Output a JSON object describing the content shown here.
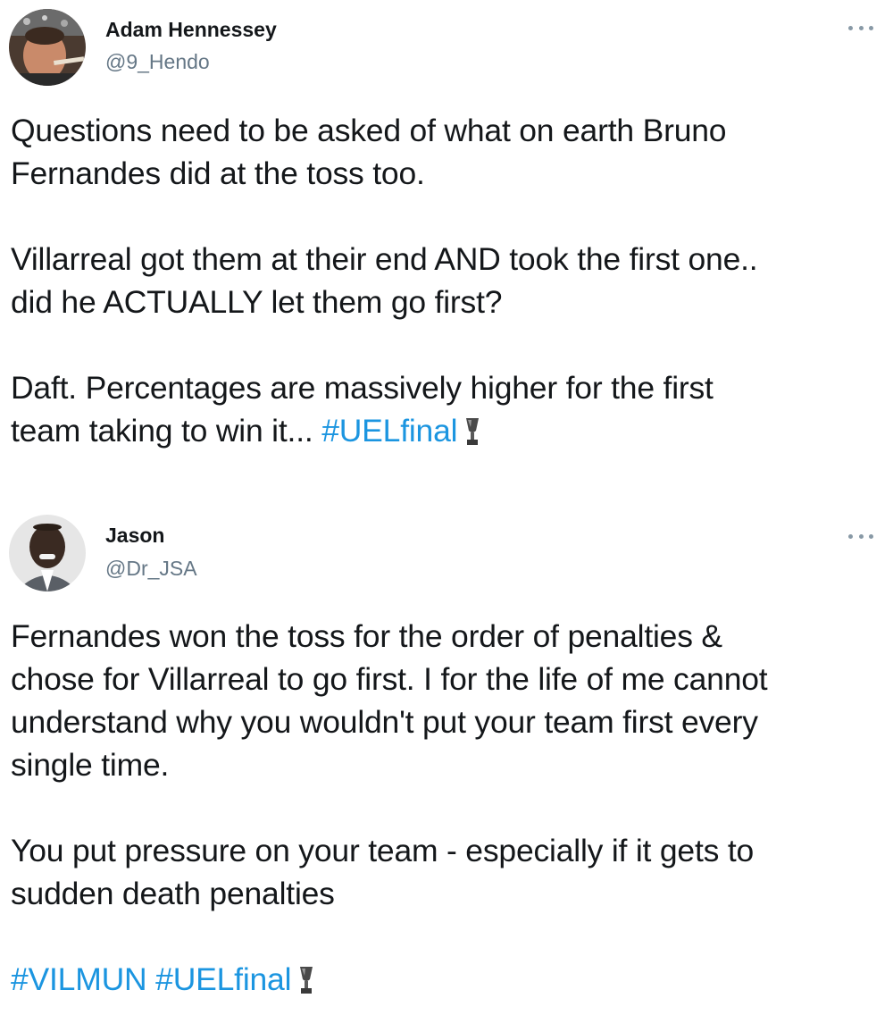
{
  "tweets": [
    {
      "author": {
        "name": "Adam Hennessey",
        "handle": "@9_Hendo",
        "avatar_icon": "profile-photo"
      },
      "more_icon": "more-options-icon",
      "paragraphs": [
        "Questions need to be asked of what on earth Bruno\nFernandes did at the toss too.",
        "Villarreal got them at their end AND took the first one..\ndid he ACTUALLY let them go first?"
      ],
      "last_paragraph": {
        "text": "Daft. Percentages are massively higher for the first\nteam taking to win it... ",
        "hashtags": [
          "#UELfinal"
        ],
        "trailing_emoji": "trophy-icon"
      }
    },
    {
      "author": {
        "name": "Jason",
        "handle": "@Dr_JSA",
        "avatar_icon": "profile-photo"
      },
      "more_icon": "more-options-icon",
      "paragraphs": [
        "Fernandes won the toss for the order of penalties &\nchose for Villarreal to go first. I for the life of me cannot\nunderstand why you wouldn't put your team first every\nsingle time.",
        "You put pressure on your team - especially if it gets to\nsudden death penalties"
      ],
      "last_paragraph": {
        "text": "",
        "hashtags": [
          "#VILMUN",
          "#UELfinal"
        ],
        "trailing_emoji": "trophy-icon"
      }
    }
  ],
  "colors": {
    "text": "#14171a",
    "handle": "#657786",
    "hashtag": "#1b95e0",
    "more_dots": "#8899a6"
  }
}
